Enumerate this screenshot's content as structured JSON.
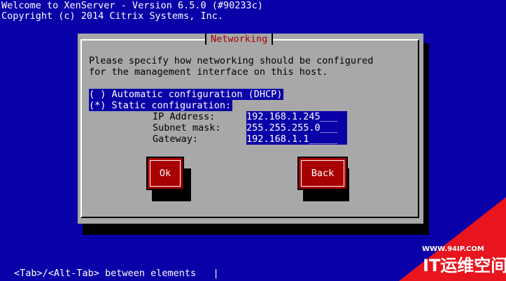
{
  "header": {
    "line1": "Welcome to XenServer - Version 6.5.0 (#90233c)",
    "line2": "Copyright (c) 2014 Citrix Systems, Inc."
  },
  "dialog": {
    "title": "Networking",
    "description_line1": "Please specify how networking should be configured",
    "description_line2": "for the management interface on this host.",
    "options": [
      {
        "label": "( ) Automatic configuration (DHCP)"
      },
      {
        "label": "(*) Static configuration:"
      }
    ],
    "fields": {
      "ip_label": "IP Address:",
      "ip_value": "192.168.1.245___",
      "mask_label": "Subnet mask:",
      "mask_value": "255.255.255.0___",
      "gateway_label": "Gateway:",
      "gateway_value": "192.168.1.1_____"
    },
    "buttons": {
      "ok": "Ok",
      "back": "Back"
    }
  },
  "footer": {
    "hint": "<Tab>/<Alt-Tab> between elements   |"
  },
  "watermark": {
    "url": "WWW.94IP.COM",
    "name": "IT运维空间"
  },
  "colors": {
    "background": "#0a00a8",
    "dialog": "#a8a8a8",
    "title": "#a80000",
    "button": "#a80000"
  }
}
